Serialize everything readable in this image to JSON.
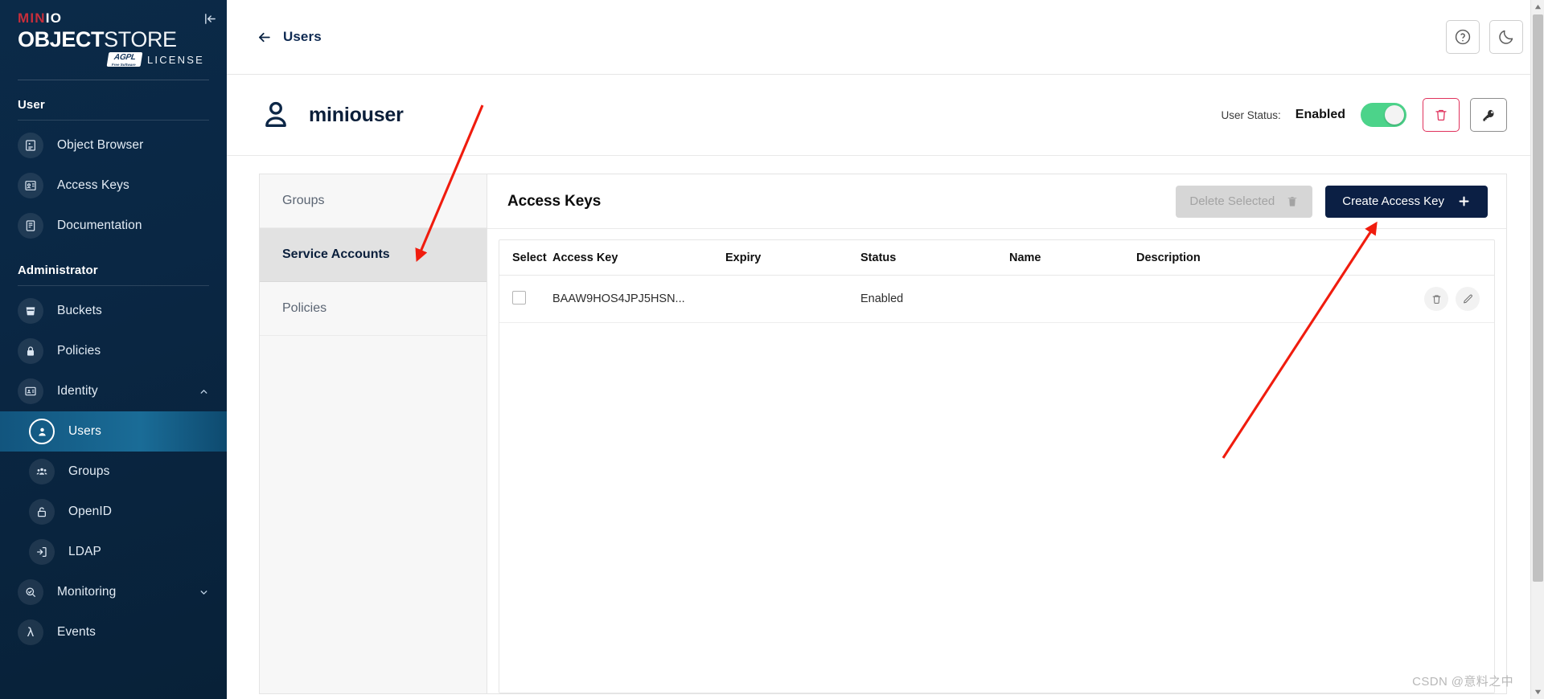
{
  "sidebar": {
    "logo": {
      "brand_min": "MIN",
      "brand_io": "IO",
      "product_bold": "OBJECT",
      "product_thin": "STORE",
      "badge_main": "AGPL",
      "badge_sub": "Free Software",
      "license_word": "LICENSE"
    },
    "collapse_icon": "collapse-panel-icon",
    "sections": [
      {
        "label": "User",
        "items": [
          {
            "label": "Object Browser",
            "icon": "object-browser-icon",
            "active": false
          },
          {
            "label": "Access Keys",
            "icon": "access-keys-icon",
            "active": false
          },
          {
            "label": "Documentation",
            "icon": "documentation-icon",
            "active": false
          }
        ]
      },
      {
        "label": "Administrator",
        "items": [
          {
            "label": "Buckets",
            "icon": "bucket-icon",
            "active": false
          },
          {
            "label": "Policies",
            "icon": "lock-icon",
            "active": false
          },
          {
            "label": "Identity",
            "icon": "identity-card-icon",
            "active": false,
            "expanded": true
          },
          {
            "label": "Users",
            "icon": "user-icon",
            "active": true,
            "sub": true
          },
          {
            "label": "Groups",
            "icon": "groups-icon",
            "active": false,
            "sub": true
          },
          {
            "label": "OpenID",
            "icon": "openid-lock-icon",
            "active": false,
            "sub": true
          },
          {
            "label": "LDAP",
            "icon": "ldap-login-icon",
            "active": false,
            "sub": true
          },
          {
            "label": "Monitoring",
            "icon": "monitoring-icon",
            "active": false,
            "expandable": true
          },
          {
            "label": "Events",
            "icon": "events-lambda-icon",
            "active": false
          }
        ]
      }
    ]
  },
  "topbar": {
    "back_label": "Users",
    "back_icon": "arrow-left-icon",
    "help_icon": "help-circle-icon",
    "theme_icon": "dark-mode-moon-icon"
  },
  "user_header": {
    "avatar_icon": "user-avatar-icon",
    "name": "miniouser",
    "status_label": "User Status:",
    "status_value": "Enabled",
    "toggle_on": true,
    "delete_icon": "trash-icon",
    "change_password_icon": "key-icon"
  },
  "tabs": [
    {
      "label": "Groups",
      "active": false
    },
    {
      "label": "Service Accounts",
      "active": true
    },
    {
      "label": "Policies",
      "active": false
    }
  ],
  "access_keys_panel": {
    "title": "Access Keys",
    "delete_selected_label": "Delete Selected",
    "delete_selected_icon": "trash-icon",
    "delete_selected_disabled": true,
    "create_label": "Create Access Key",
    "create_icon": "plus-icon",
    "columns": [
      "Select",
      "Access Key",
      "Expiry",
      "Status",
      "Name",
      "Description"
    ],
    "rows": [
      {
        "selected": false,
        "access_key": "BAAW9HOS4JPJ5HSN...",
        "expiry": "",
        "status": "Enabled",
        "name": "",
        "description": "",
        "actions": [
          "delete-icon",
          "edit-icon"
        ]
      }
    ]
  },
  "annotations": {
    "arrow_one_target": "service-accounts-tab",
    "arrow_two_target": "create-access-key-button",
    "arrow_color": "#f01c0e"
  },
  "watermark": "CSDN @意料之中",
  "colors": {
    "sidebar_bg": "#0b2a48",
    "accent_primary": "#0b1f44",
    "toggle_on": "#4cd38a",
    "danger": "#e0315c",
    "brand_red": "#c72e3b"
  }
}
